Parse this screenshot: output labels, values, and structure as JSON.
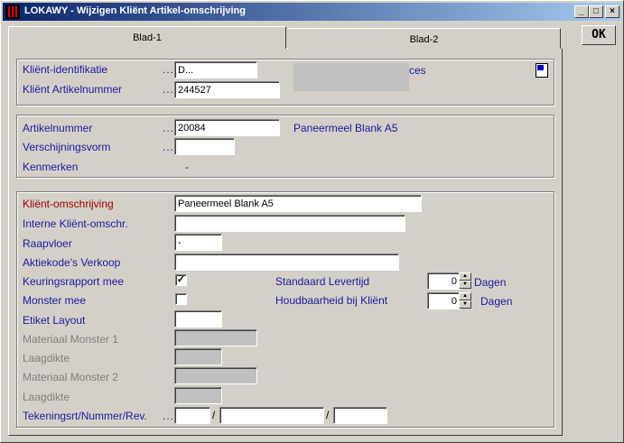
{
  "window": {
    "title": "LOKAWY - Wijzigen Kliënt Artikel-omschrijving",
    "minimize": "_",
    "maximize": "□",
    "close": "×"
  },
  "ok_label": "OK",
  "tabs": [
    {
      "label": "Blad-1"
    },
    {
      "label": "Blad-2"
    }
  ],
  "client": {
    "id_label": "Kliënt-identifikatie",
    "id_dots": "...",
    "id_value": "D...",
    "artnr_label": "Kliënt Artikelnummer",
    "artnr_dots": "...",
    "artnr_value": "244527",
    "name_suffix": "ces"
  },
  "article": {
    "artnr_label": "Artikelnummer",
    "artnr_dots": "...",
    "artnr_value": "20084",
    "description": "Paneermeel Blank A5",
    "verschijning_label": "Verschijningsvorm",
    "verschijning_dots": "...",
    "verschijning_value": "",
    "kenmerken_label": "Kenmerken",
    "kenmerken_value": "-"
  },
  "details": {
    "omschrijving_label": "Kliënt-omschrijving",
    "omschrijving_value": "Paneermeel Blank A5",
    "intern_label": "Interne Kliënt-omschr.",
    "intern_value": "",
    "raapvloer_label": "Raapvloer",
    "raapvloer_value": "-",
    "aktiekode_label": "Aktiekode's Verkoop",
    "aktiekode_value": "",
    "keuring_label": "Keuringsrapport mee",
    "keuring_checked": "✓",
    "monster_label": "Monster mee",
    "monster_checked": "",
    "levertijd_label": "Standaard Levertijd",
    "levertijd_value": "0",
    "levertijd_unit": "Dagen",
    "houdbaarheid_label": "Houdbaarheid bij Kliënt",
    "houdbaarheid_value": "0",
    "houdbaarheid_unit": "Dagen",
    "etiket_label": "Etiket Layout",
    "etiket_value": "",
    "materiaal1_label": "Materiaal Monster 1",
    "laagdikte1_label": "Laagdikte",
    "materiaal2_label": "Materiaal Monster 2",
    "laagdikte2_label": "Laagdikte",
    "tekening_label": "Tekeningsrt/Nummer/Rev.",
    "tekening_dots": "...",
    "slash": "/"
  }
}
